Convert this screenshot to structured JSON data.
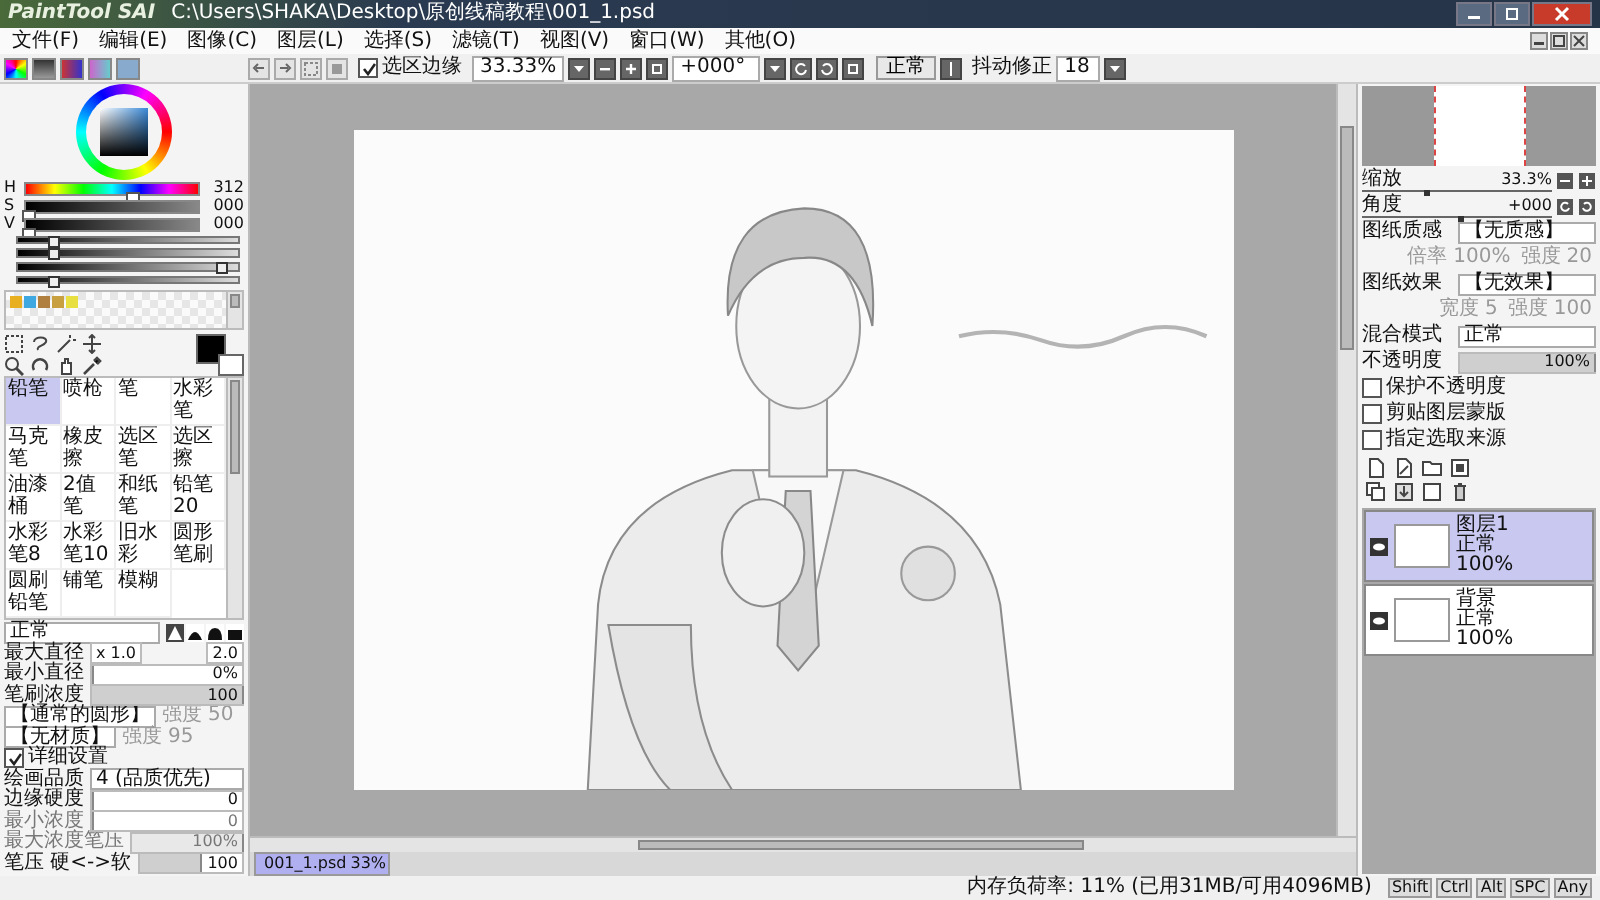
{
  "title_bar": {
    "logo": "PaintTool SAI",
    "path": "C:\\Users\\SHAKA\\Desktop\\原创线稿教程\\001_1.psd"
  },
  "menu": [
    "文件(F)",
    "编辑(E)",
    "图像(C)",
    "图层(L)",
    "选择(S)",
    "滤镜(T)",
    "视图(V)",
    "窗口(W)",
    "其他(O)"
  ],
  "toolbar": {
    "selection_edge": {
      "label": "选区边缘",
      "checked": true
    },
    "zoom": "33.33%",
    "rotation": "+000°",
    "blend": "正常",
    "stabilizer_label": "抖动修正",
    "stabilizer": "18"
  },
  "color": {
    "hsv": [
      {
        "label": "H",
        "value": "312",
        "level": 0.6
      },
      {
        "label": "S",
        "value": "000",
        "level": 0.0
      },
      {
        "label": "V",
        "value": "000",
        "level": 0.0
      }
    ],
    "mixers": [
      {
        "level": 0.15
      },
      {
        "level": 0.15
      },
      {
        "level": 0.92
      },
      {
        "level": 0.15
      }
    ],
    "swatches": [
      {
        "color": "#e8b020"
      },
      {
        "color": "#40a8e0"
      },
      {
        "color": "#b08040"
      },
      {
        "color": "#c8a040"
      },
      {
        "color": "#e8e040"
      }
    ]
  },
  "tools": [
    {
      "label": "铅笔",
      "selected": true
    },
    {
      "label": "喷枪",
      "selected": false
    },
    {
      "label": "笔",
      "selected": false
    },
    {
      "label": "水彩笔",
      "selected": false
    },
    {
      "label": "马克笔",
      "selected": false
    },
    {
      "label": "橡皮擦",
      "selected": false
    },
    {
      "label": "选区笔",
      "selected": false
    },
    {
      "label": "选区擦",
      "selected": false
    },
    {
      "label": "油漆桶",
      "selected": false
    },
    {
      "label": "2值笔",
      "selected": false
    },
    {
      "label": "和纸笔",
      "selected": false
    },
    {
      "label": "铅笔20",
      "selected": false
    },
    {
      "label": "水彩笔8",
      "selected": false
    },
    {
      "label": "水彩笔10",
      "selected": false
    },
    {
      "label": "旧水彩",
      "selected": false
    },
    {
      "label": "圆形笔刷",
      "selected": false
    },
    {
      "label": "圆刷铅笔",
      "selected": false
    },
    {
      "label": "铺笔",
      "selected": false
    },
    {
      "label": "模糊",
      "selected": false
    }
  ],
  "brush": {
    "mode": "正常",
    "tips": [
      {
        "selected": true
      },
      {
        "selected": false
      },
      {
        "selected": false
      },
      {
        "selected": false
      }
    ],
    "max_size": {
      "label": "最大直径",
      "multiplier": "x 1.0",
      "value": "2.0"
    },
    "min_size": {
      "label": "最小直径",
      "value": "0%",
      "level": 0.0
    },
    "density": {
      "label": "笔刷浓度",
      "value": "100",
      "level": 1.0
    },
    "shape": {
      "value": "【通常的圆形】",
      "sub_label": "强度",
      "sub_value": "50"
    },
    "texture": {
      "value": "【无材质】",
      "sub_label": "强度",
      "sub_value": "95"
    },
    "advanced": {
      "label": "详细设置",
      "checked": true
    },
    "quality": {
      "label": "绘画品质",
      "value": "4 (品质优先)"
    },
    "sliders": [
      {
        "label": "边缘硬度",
        "value": "0",
        "level": 0.0,
        "disabled": false
      },
      {
        "label": "最小浓度",
        "value": "0",
        "level": 0.0,
        "disabled": true
      },
      {
        "label": "最大浓度笔压",
        "value": "100%",
        "level": 1.0,
        "disabled": true
      },
      {
        "label": "笔压 硬<->软",
        "value": "100",
        "level": 0.6,
        "disabled": false
      }
    ]
  },
  "document_tab": {
    "name": "001_1.psd",
    "zoom": "33%",
    "selected": true
  },
  "navigator": {
    "rows": [
      {
        "label": "缩放",
        "value": "33.3%",
        "level": 0.33
      },
      {
        "label": "角度",
        "value": "+000",
        "level": 0.5
      }
    ]
  },
  "paper": [
    {
      "label": "图纸质感",
      "value": "【无质感】",
      "sub": [
        {
          "label": "倍率",
          "value": "100%"
        },
        {
          "label": "强度",
          "value": "20"
        }
      ]
    },
    {
      "label": "图纸效果",
      "value": "【无效果】",
      "sub": [
        {
          "label": "宽度",
          "value": "5"
        },
        {
          "label": "强度",
          "value": "100"
        }
      ]
    }
  ],
  "layer_props": {
    "mode_label": "混合模式",
    "mode": "正常",
    "opacity_label": "不透明度",
    "opacity": "100%",
    "level": 1.0,
    "options": [
      {
        "label": "保护不透明度",
        "checked": false
      },
      {
        "label": "剪贴图层蒙版",
        "checked": false
      },
      {
        "label": "指定选取来源",
        "checked": false
      }
    ]
  },
  "layers": [
    {
      "name": "图层1",
      "mode": "正常",
      "opacity": "100%",
      "selected": true,
      "visible": true
    },
    {
      "name": "背景",
      "mode": "正常",
      "opacity": "100%",
      "selected": false,
      "visible": true
    }
  ],
  "status": {
    "memory": "内存负荷率: 11% (已用31MB/可用4096MB)",
    "keys": [
      "Shift",
      "Ctrl",
      "Alt",
      "SPC",
      "Any"
    ]
  }
}
